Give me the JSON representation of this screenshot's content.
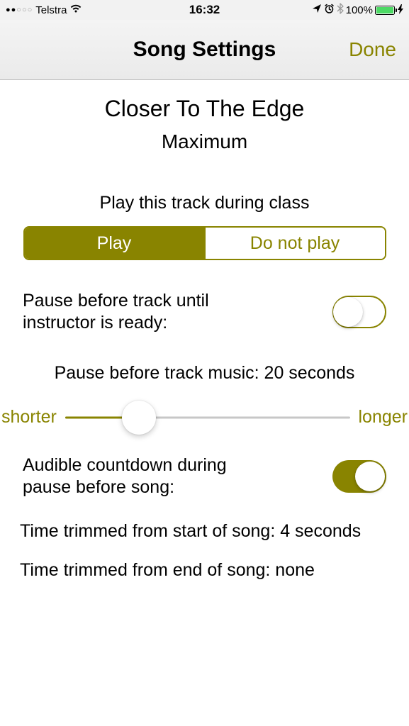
{
  "statusBar": {
    "carrier": "Telstra",
    "time": "16:32",
    "batteryPct": "100%"
  },
  "nav": {
    "title": "Song Settings",
    "done": "Done"
  },
  "song": {
    "title": "Closer To The Edge",
    "artist": "Maximum"
  },
  "playSection": {
    "label": "Play this track during class",
    "playLabel": "Play",
    "doNotPlayLabel": "Do not play"
  },
  "pauseReady": {
    "label": "Pause before track until instructor is ready:"
  },
  "pauseDuration": {
    "label": "Pause before track music: 20 seconds"
  },
  "slider": {
    "shorter": "shorter",
    "longer": "longer",
    "percent": 26
  },
  "countdown": {
    "label": "Audible countdown during pause before song:"
  },
  "trimStart": "Time trimmed from start of song: 4 seconds",
  "trimEnd": "Time trimmed from end of song: none"
}
